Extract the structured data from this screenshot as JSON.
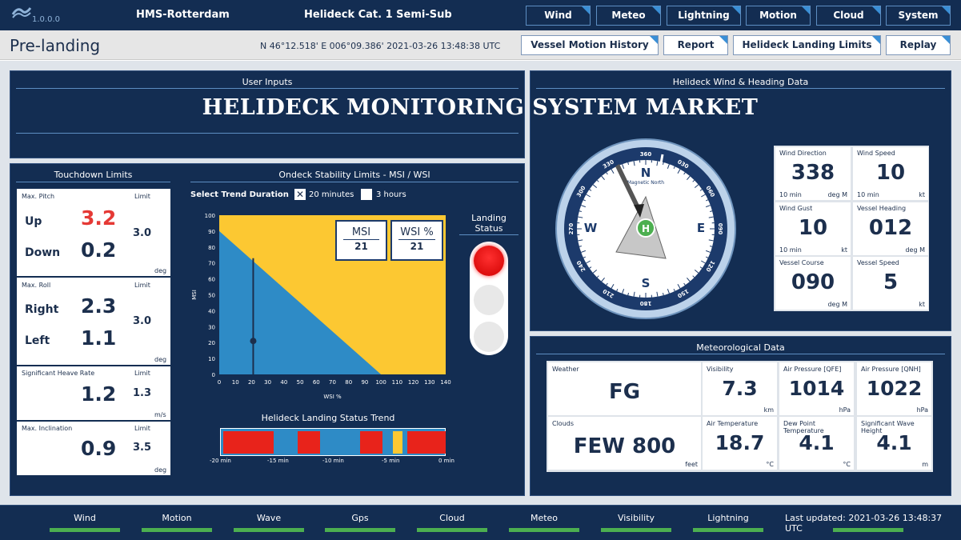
{
  "header": {
    "version": "1.0.0.0",
    "vessel": "HMS-Rotterdam",
    "helideck": "Helideck Cat. 1 Semi-Sub",
    "menu": [
      "Wind",
      "Meteo",
      "Lightning",
      "Motion",
      "Cloud",
      "System"
    ]
  },
  "subbar": {
    "page_title": "Pre-landing",
    "coords": "N 46°12.518'  E 006°09.386'  2021-03-26 13:48:38 UTC",
    "buttons": [
      "Vessel Motion History",
      "Report",
      "Helideck Landing Limits",
      "Replay"
    ]
  },
  "user_inputs": {
    "title": "User Inputs"
  },
  "watermark": "HELIDECK MONITORING SYSTEM MARKET",
  "touchdown": {
    "title": "Touchdown Limits",
    "limit_label": "Limit",
    "pitch": {
      "label": "Max. Pitch",
      "up_label": "Up",
      "up": "3.2",
      "down_label": "Down",
      "down": "0.2",
      "limit": "3.0",
      "unit": "deg"
    },
    "roll": {
      "label": "Max. Roll",
      "right_label": "Right",
      "right": "2.3",
      "left_label": "Left",
      "left": "1.1",
      "limit": "3.0",
      "unit": "deg"
    },
    "heave": {
      "label": "Significant Heave Rate",
      "value": "1.2",
      "limit": "1.3",
      "unit": "m/s"
    },
    "inclination": {
      "label": "Max. Inclination",
      "value": "0.9",
      "limit": "3.5",
      "unit": "deg"
    }
  },
  "stability": {
    "title": "Ondeck Stability Limits - MSI / WSI",
    "trend_label": "Select Trend Duration",
    "opt_20": "20 minutes",
    "opt_3h": "3 hours",
    "msi_label": "MSI",
    "msi_value": "21",
    "wsi_label": "WSI %",
    "wsi_value": "21",
    "landing_status": "Landing Status",
    "trend_title": "Helideck Landing Status Trend",
    "trend_ticks": [
      "-20 min",
      "-15 min",
      "-10 min",
      "-5 min",
      "0 min"
    ]
  },
  "chart_data": {
    "type": "scatter",
    "xlabel": "WSI %",
    "ylabel": "MSI",
    "xlim": [
      0,
      140
    ],
    "ylim": [
      0,
      100
    ],
    "x_ticks": [
      0,
      10,
      20,
      30,
      40,
      50,
      60,
      70,
      80,
      90,
      100,
      110,
      120,
      130,
      140
    ],
    "y_ticks": [
      0,
      10,
      20,
      30,
      40,
      50,
      60,
      70,
      80,
      90,
      100
    ],
    "limit_line": [
      [
        0,
        90
      ],
      [
        100,
        0
      ]
    ],
    "series": [
      {
        "x": [
          21
        ],
        "y": [
          21
        ]
      }
    ],
    "point_range": {
      "x": 21,
      "y_min": 0,
      "y_max": 73
    },
    "colors": {
      "safe": "#2e8bc6",
      "limit": "#fcc832"
    }
  },
  "wind": {
    "title": "Helideck Wind & Heading Data",
    "compass": {
      "n": "N",
      "e": "E",
      "s": "S",
      "w": "W",
      "magnetic": "Magnetic North",
      "degrees": [
        "360",
        "030",
        "060",
        "090",
        "120",
        "150",
        "180",
        "210",
        "240",
        "270",
        "300",
        "330"
      ]
    },
    "cards": [
      {
        "label": "Wind Direction",
        "value": "338",
        "sub": "10 min",
        "unit": "deg M"
      },
      {
        "label": "Wind Speed",
        "value": "10",
        "sub": "10 min",
        "unit": "kt"
      },
      {
        "label": "Wind Gust",
        "value": "10",
        "sub": "10 min",
        "unit": "kt"
      },
      {
        "label": "Vessel Heading",
        "value": "012",
        "sub": "",
        "unit": "deg M"
      },
      {
        "label": "Vessel Course",
        "value": "090",
        "sub": "",
        "unit": "deg M"
      },
      {
        "label": "Vessel Speed",
        "value": "5",
        "sub": "",
        "unit": "kt"
      }
    ]
  },
  "meteo": {
    "title": "Meteorological Data",
    "cards": [
      {
        "label": "Weather",
        "value": "FG",
        "unit": ""
      },
      {
        "label": "Visibility",
        "value": "7.3",
        "unit": "km"
      },
      {
        "label": "Air Pressure [QFE]",
        "value": "1014",
        "unit": "hPa"
      },
      {
        "label": "Air Pressure [QNH]",
        "value": "1022",
        "unit": "hPa"
      },
      {
        "label": "Clouds",
        "value": "FEW 800",
        "unit": "feet"
      },
      {
        "label": "Air Temperature",
        "value": "18.7",
        "unit": "°C"
      },
      {
        "label": "Dew Point Temperature",
        "value": "4.1",
        "unit": "°C"
      },
      {
        "label": "Significant Wave Height",
        "value": "4.1",
        "unit": "m"
      }
    ]
  },
  "footer": {
    "items": [
      "Wind",
      "Motion",
      "Wave",
      "Gps",
      "Cloud",
      "Meteo",
      "Visibility",
      "Lightning"
    ],
    "last_updated": "Last updated: 2021-03-26 13:48:37 UTC"
  }
}
